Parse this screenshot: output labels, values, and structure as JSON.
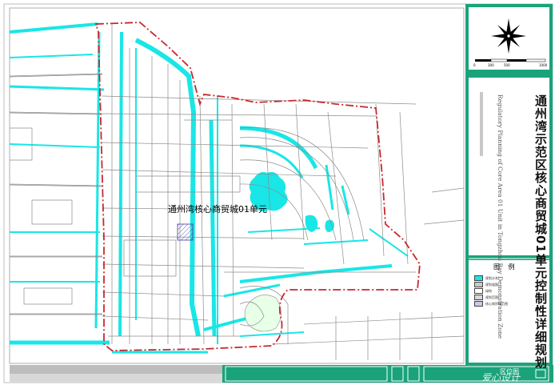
{
  "map": {
    "plan_unit_label": "通州湾核心商贸城01单元"
  },
  "title_block": {
    "title_cn": "通州湾示范区核心商贸城01单元控制性详细规划",
    "title_en": "Regulatory Planning of Core Area 01 Unit in Tongzhou Bay Demonstration Zone"
  },
  "scale_bar": {
    "labels": [
      "0",
      "300",
      "500",
      "1000"
    ]
  },
  "legend": {
    "title": "图 例",
    "items": [
      {
        "label": "规划水系",
        "color": "#19e6e6"
      },
      {
        "label": "规划道路",
        "color": "#c9c9c9"
      },
      {
        "label": "绿地",
        "color": "#ffffff"
      },
      {
        "label": "规划范围",
        "color": "#d8d8d8"
      },
      {
        "label": "核心商贸城范围",
        "color": "#c8c8f0"
      }
    ]
  },
  "bottom_bar": {
    "location_label": "区位图",
    "watermark": "爱心设计"
  },
  "colors": {
    "frame_green": "#1aa37a",
    "water": "#19e6e6",
    "boundary": "#c8282d",
    "roads": "#8c8c8c"
  }
}
